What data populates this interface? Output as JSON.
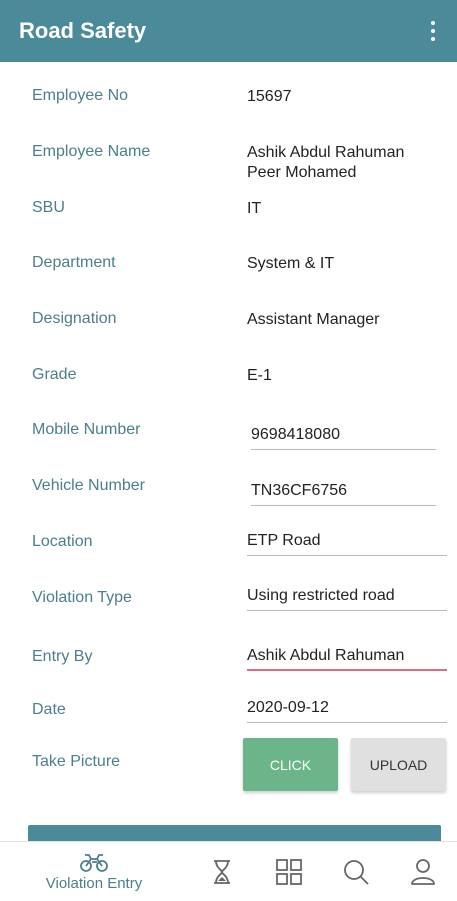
{
  "app_bar": {
    "title": "Road Safety"
  },
  "fields": {
    "employee_no": {
      "label": "Employee No",
      "value": "15697"
    },
    "employee_name": {
      "label": "Employee Name",
      "value_line1": "Ashik Abdul Rahuman",
      "value_line2": "Peer Mohamed"
    },
    "sbu": {
      "label": "SBU",
      "value": "IT"
    },
    "department": {
      "label": "Department",
      "value": "System & IT"
    },
    "designation": {
      "label": "Designation",
      "value": "Assistant Manager"
    },
    "grade": {
      "label": "Grade",
      "value": "E-1"
    },
    "mobile_number": {
      "label": "Mobile Number",
      "value": "9698418080"
    },
    "vehicle_number": {
      "label": "Vehicle Number",
      "value": "TN36CF6756"
    },
    "location": {
      "label": "Location",
      "value": "ETP Road"
    },
    "violation_type": {
      "label": "Violation Type",
      "value": "Using restricted road"
    },
    "entry_by": {
      "label": "Entry By",
      "value": "Ashik Abdul Rahuman"
    },
    "date": {
      "label": "Date",
      "value": "2020-09-12"
    },
    "take_picture": {
      "label": "Take Picture",
      "click_label": "CLICK",
      "upload_label": "UPLOAD"
    }
  },
  "bottom_nav": {
    "items": [
      {
        "label": "Violation Entry",
        "icon": "motorcycle-icon",
        "active": true
      },
      {
        "label": "",
        "icon": "hourglass-icon"
      },
      {
        "label": "",
        "icon": "grid-icon"
      },
      {
        "label": "",
        "icon": "search-icon"
      },
      {
        "label": "",
        "icon": "profile-icon"
      }
    ]
  },
  "colors": {
    "primary": "#4a8a99",
    "label": "#4a7f8c",
    "click_button": "#6cb58b",
    "upload_button": "#e0e0e0",
    "focus_underline": "#e06a88"
  }
}
